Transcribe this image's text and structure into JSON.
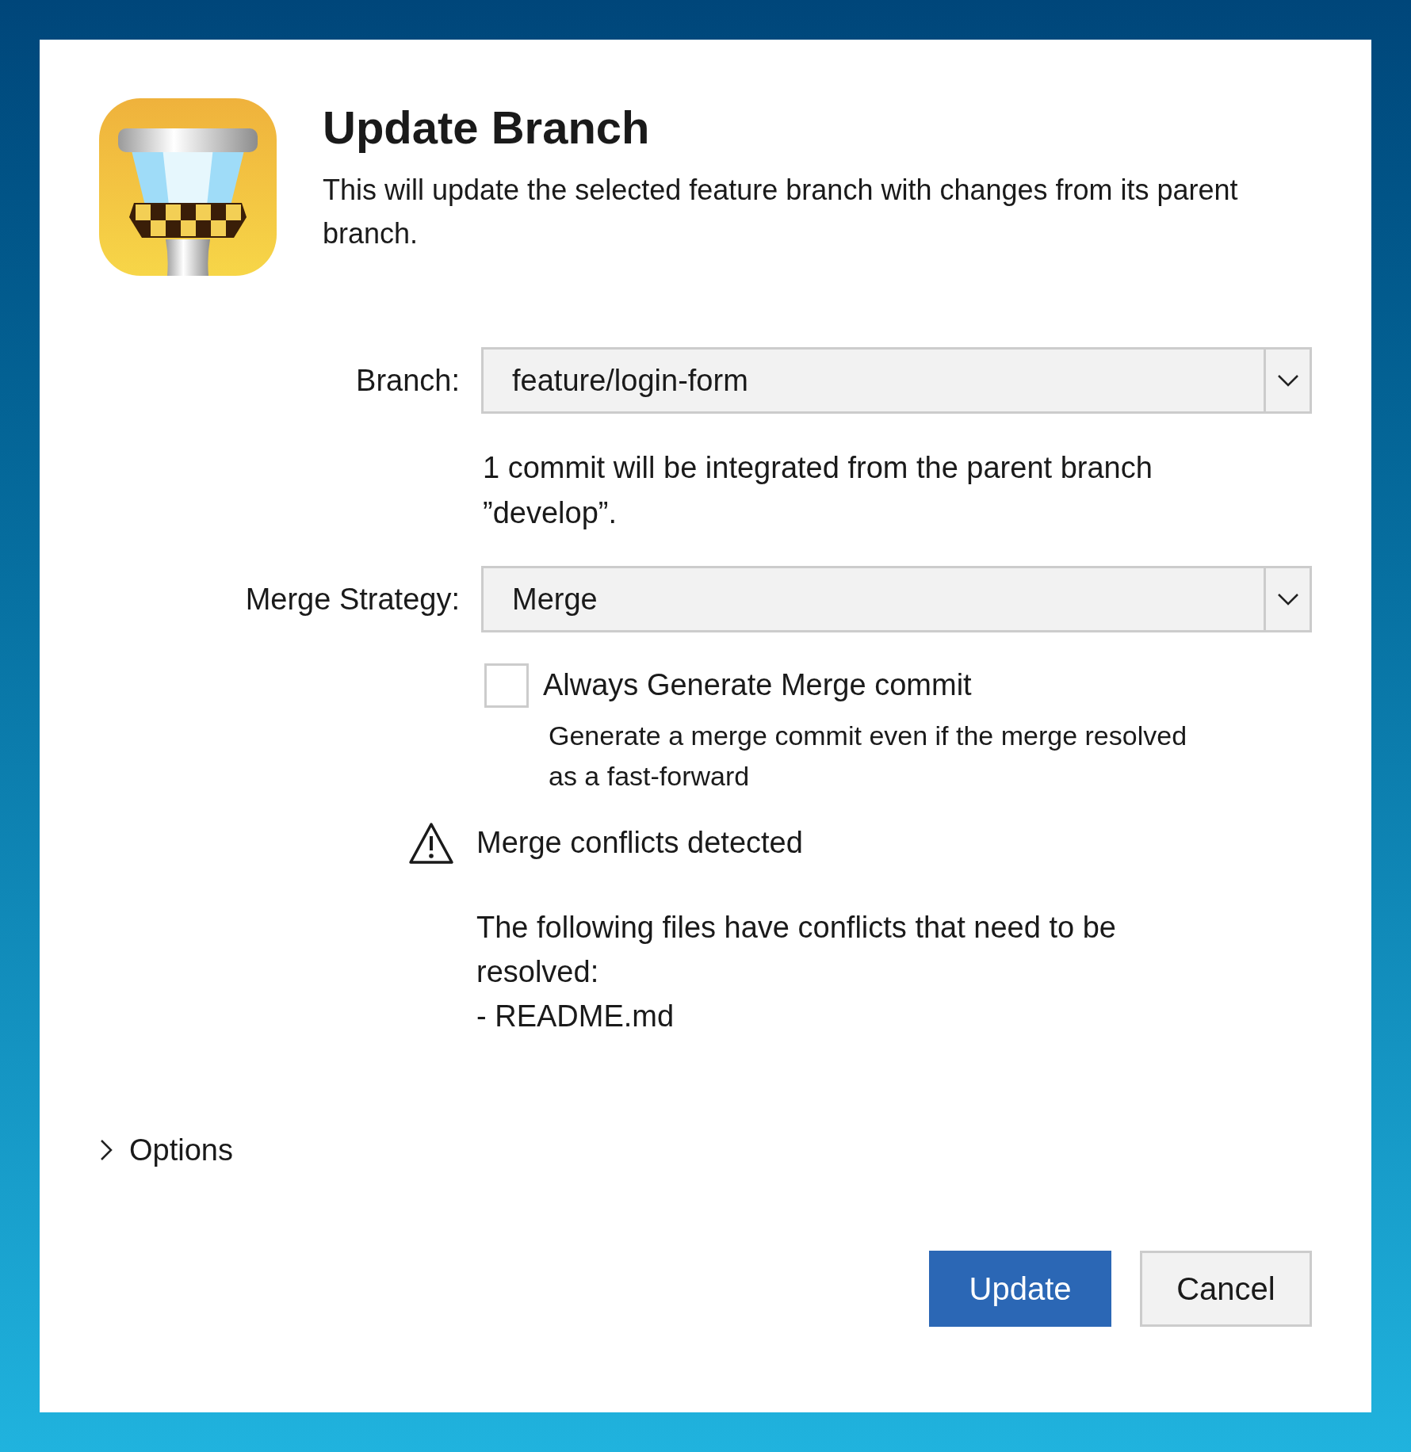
{
  "dialog": {
    "title": "Update Branch",
    "description": "This will update the selected feature branch with changes from its parent branch."
  },
  "branch": {
    "label": "Branch:",
    "value": "feature/login-form"
  },
  "commit_note": "1 commit will be integrated from the parent branch ”develop”.",
  "merge_strategy": {
    "label": "Merge Strategy:",
    "value": "Merge"
  },
  "checkbox": {
    "label": "Always Generate Merge commit",
    "checked": false,
    "description": "Generate a merge commit even if the merge resolved as a fast-forward"
  },
  "warning": {
    "title": "Merge conflicts detected",
    "message": "The following files have conflicts that need to be resolved:",
    "files": [
      "- README.md"
    ]
  },
  "options": {
    "label": "Options",
    "expanded": false
  },
  "buttons": [
    {
      "label": "Update",
      "kind": "primary"
    },
    {
      "label": "Cancel",
      "kind": "secondary"
    }
  ]
}
